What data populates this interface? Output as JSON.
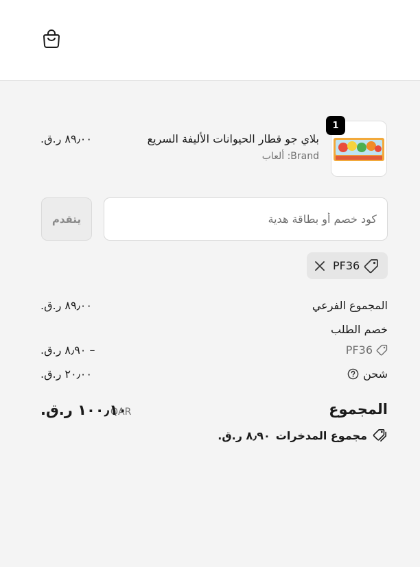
{
  "header": {
    "cart_icon": "shopping-bag-icon"
  },
  "line_item": {
    "quantity": "1",
    "title": "بلاي جو قطار الحيوانات الأليفة السريع",
    "brand": "Brand: ألعاب",
    "price": "٨٩٫٠٠ ر.ق."
  },
  "discount": {
    "placeholder": "كود خصم أو بطاقة هدية",
    "apply_label": "يتقدم"
  },
  "applied_code": {
    "code": "PF36"
  },
  "summary": {
    "subtotal_label": "المجموع الفرعي",
    "subtotal_value": "٨٩٫٠٠ ر.ق.",
    "order_discount_label": "خصم الطلب",
    "order_discount_code": "PF36",
    "order_discount_value": "– ٨٫٩٠ ر.ق.",
    "shipping_label": "شحن",
    "shipping_value": "٢٠٫٠٠ ر.ق.",
    "total_label": "المجموع",
    "currency": "QAR",
    "total_value": "١٠٠٫١٠ ر.ق.",
    "savings_label": "مجموع المدخرات",
    "savings_value": "٨٫٩٠ ر.ق."
  },
  "colors": {
    "background": "#f4f4f4",
    "badge": "#000000",
    "muted": "#707070"
  }
}
